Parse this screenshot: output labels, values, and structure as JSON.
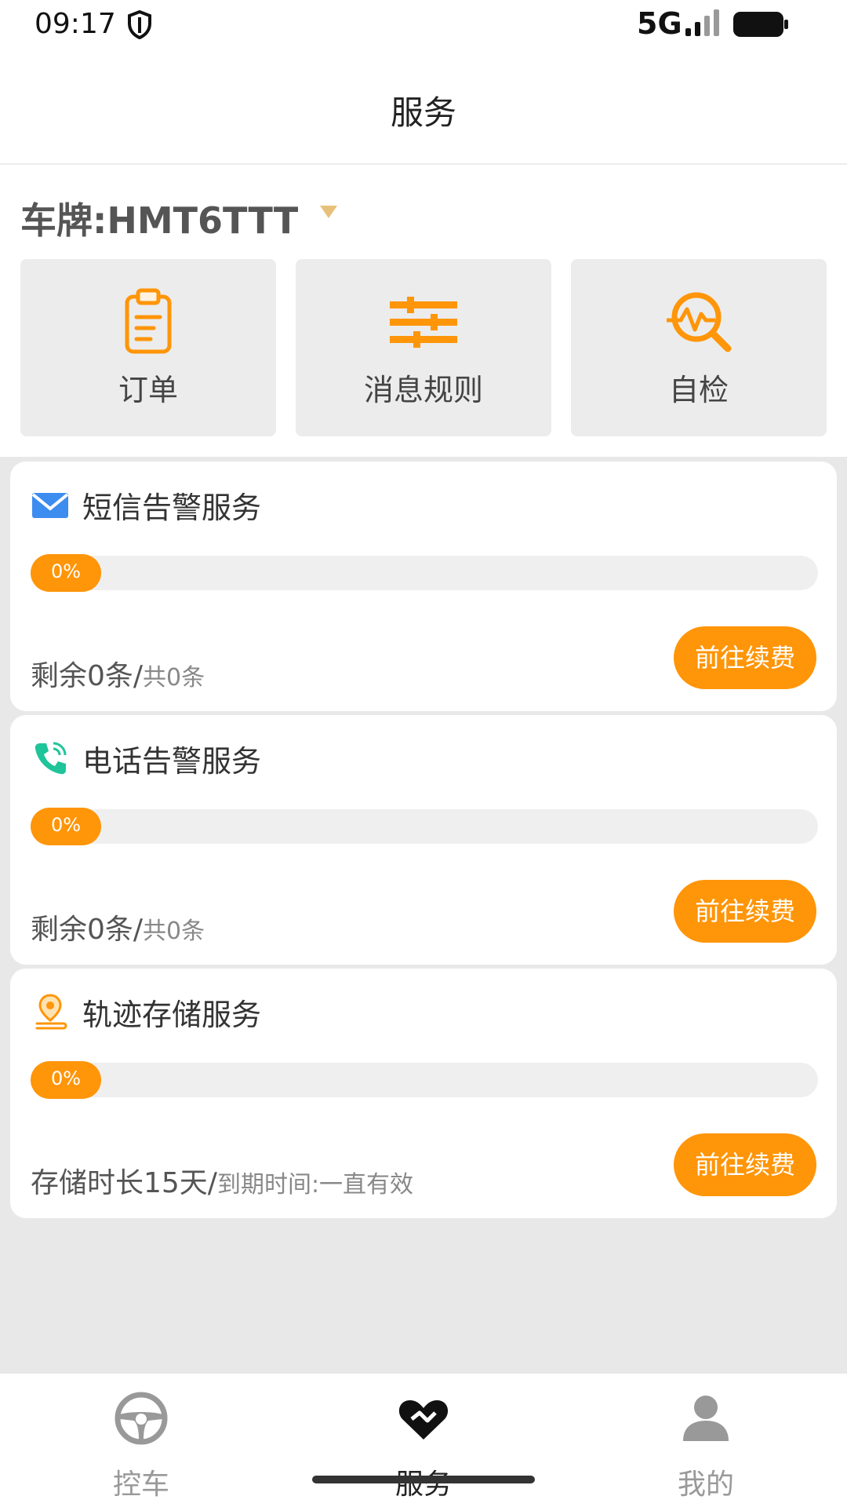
{
  "status_bar": {
    "time": "09:17",
    "network": "5G"
  },
  "header": {
    "title": "服务"
  },
  "plate": {
    "label": "车牌:HMT6TTT"
  },
  "quick_actions": [
    {
      "label": "订单",
      "icon": "clipboard-icon"
    },
    {
      "label": "消息规则",
      "icon": "sliders-icon"
    },
    {
      "label": "自检",
      "icon": "diagnostic-search-icon"
    }
  ],
  "services": [
    {
      "title": "短信告警服务",
      "icon": "mail-icon",
      "progress": 0,
      "progress_text": "0%",
      "remaining": "剩余0条/",
      "total": "共0条",
      "button": "前往续费"
    },
    {
      "title": "电话告警服务",
      "icon": "phone-icon",
      "progress": 0,
      "progress_text": "0%",
      "remaining": "剩余0条/",
      "total": "共0条",
      "button": "前往续费"
    },
    {
      "title": "轨迹存储服务",
      "icon": "location-pin-icon",
      "progress": 0,
      "progress_text": "0%",
      "remaining": "存储时长15天/",
      "total": "到期时间:一直有效",
      "button": "前往续费"
    }
  ],
  "bottom_nav": [
    {
      "label": "控车",
      "icon": "steering-wheel-icon",
      "active": false
    },
    {
      "label": "服务",
      "icon": "heart-handshake-icon",
      "active": true
    },
    {
      "label": "我的",
      "icon": "user-icon",
      "active": false
    }
  ],
  "colors": {
    "accent": "#ff9508",
    "caret": "#e7c17a",
    "background": "#e8e8e8"
  }
}
